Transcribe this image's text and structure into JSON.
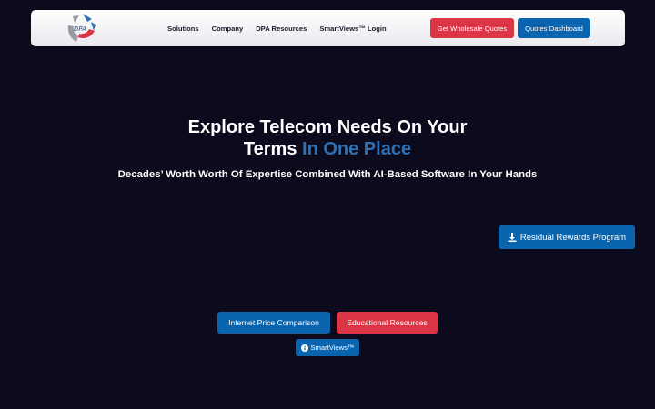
{
  "header": {
    "logo_text": "DPA",
    "nav": [
      "Solutions",
      "Company",
      "DPA Resources",
      "SmartViews™ Login"
    ],
    "wholesale_quotes_label": "Get Wholesale Quotes",
    "quotes_dashboard_label": "Quotes Dashboard"
  },
  "hero": {
    "title_line1": "Explore Telecom Needs On Your",
    "title_line2_plain": "Terms",
    "title_line2_accent": "In One Place",
    "subtitle": "Decades’ Worth Worth Of Expertise Combined With AI-Based Software In Your Hands"
  },
  "residual_rewards_label": "Residual Rewards Program",
  "internet_price_label": "Internet Price Comparison",
  "educational_resources_label": "Educational Resources",
  "smartviews_label": "SmartViews™",
  "colors": {
    "background": "#0b0b1d",
    "accent_red": "#dc3545",
    "accent_blue": "#0b64ae",
    "title_accent": "#2f6fb3"
  }
}
